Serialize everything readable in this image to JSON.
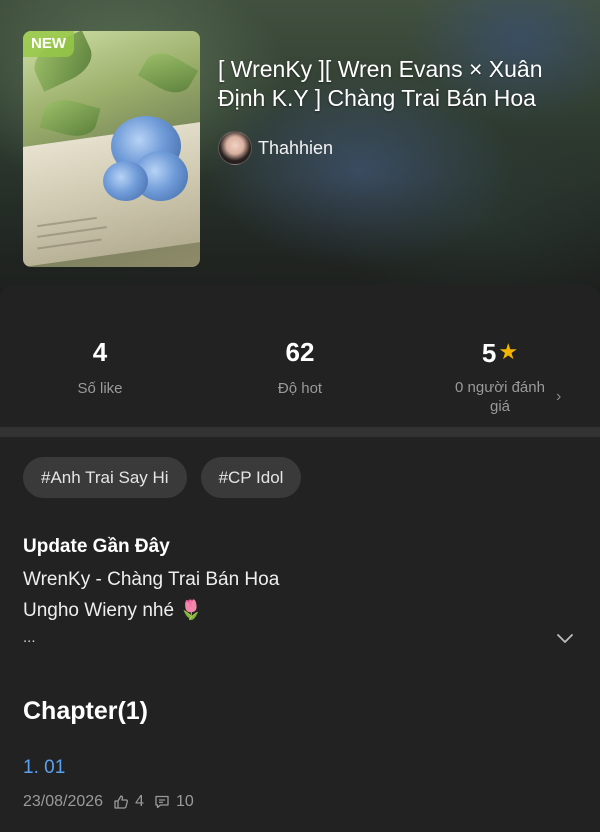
{
  "cover": {
    "badge": "NEW"
  },
  "story": {
    "title": "[ WrenKy ][ Wren Evans × Xuân Định K.Y ] Chàng Trai Bán Hoa",
    "author": "Thahhien"
  },
  "stats": [
    {
      "value": "4",
      "label": "Số like"
    },
    {
      "value": "62",
      "label": "Độ hot"
    },
    {
      "value": "5",
      "label": "0 người đánh giá",
      "icon": "star-icon"
    }
  ],
  "tags": [
    "#Anh Trai Say Hi",
    "#CP Idol"
  ],
  "update": {
    "heading": "Update Gần Đây",
    "line1": "WrenKy - Chàng Trai Bán Hoa",
    "line2": "Ungho Wieny nhé 🌷",
    "ellipsis": "..."
  },
  "chapters": {
    "heading": "Chapter(1)",
    "items": [
      {
        "title": "1. 01",
        "date": "23/08/2026",
        "likes": "4",
        "comments": "10"
      }
    ]
  },
  "colors": {
    "background": "#222222",
    "link": "#5aa2f0",
    "star": "#f5b400",
    "new_badge": "#96c846"
  }
}
